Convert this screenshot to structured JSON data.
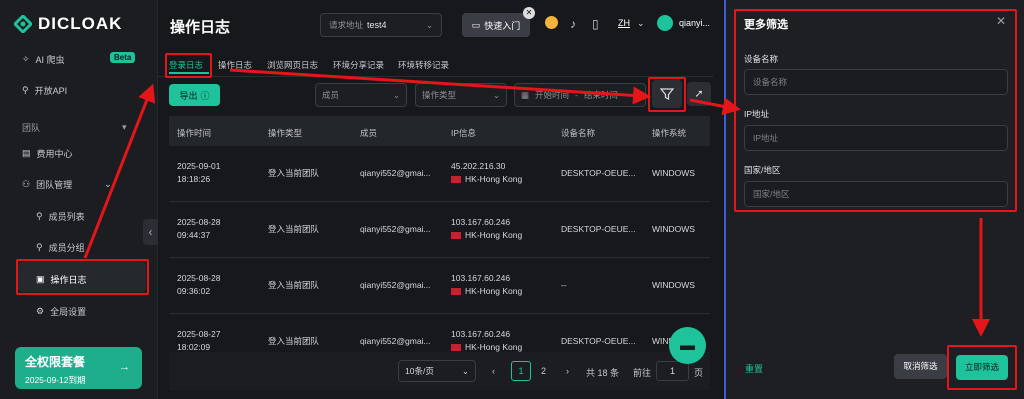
{
  "app": {
    "logo_text": "DICLOAK"
  },
  "sidebar": {
    "ai": "AI 爬虫",
    "ai_badge": "Beta",
    "api": "开放API",
    "team_section": "团队",
    "billing": "费用中心",
    "team_mgmt": "团队管理",
    "members": "成员列表",
    "groups": "成员分组",
    "logs": "操作日志",
    "settings": "全局设置",
    "package": {
      "title": "全权限套餐",
      "expire": "2025-09-12到期"
    }
  },
  "header": {
    "title": "操作日志",
    "address_label": "请求地址",
    "address_value": "test4",
    "quick_entry": "快速入门",
    "lang": "ZH",
    "username": "qianyi..."
  },
  "tabs": [
    "登录日志",
    "操作日志",
    "浏览网页日志",
    "环境分享记录",
    "环境转移记录"
  ],
  "toolbar": {
    "export": "导出",
    "member_placeholder": "成员",
    "type_placeholder": "操作类型",
    "start_time": "开始时间",
    "end_time": "结束时间"
  },
  "table": {
    "headers": [
      "操作时间",
      "操作类型",
      "成员",
      "IP信息",
      "设备名称",
      "操作系统"
    ],
    "rows": [
      {
        "date": "2025-09-01",
        "time": "18:18:26",
        "type": "登入当前团队",
        "member": "qianyi552@gmai...",
        "ip": "45.202.216.30",
        "region": "HK-Hong Kong",
        "device": "DESKTOP-OEUE...",
        "os": "WINDOWS"
      },
      {
        "date": "2025-08-28",
        "time": "09:44:37",
        "type": "登入当前团队",
        "member": "qianyi552@gmai...",
        "ip": "103.167.60.246",
        "region": "HK-Hong Kong",
        "device": "DESKTOP-OEUE...",
        "os": "WINDOWS"
      },
      {
        "date": "2025-08-28",
        "time": "09:36:02",
        "type": "登入当前团队",
        "member": "qianyi552@gmai...",
        "ip": "103.167.60.246",
        "region": "HK-Hong Kong",
        "device": "--",
        "os": "WINDOWS"
      },
      {
        "date": "2025-08-27",
        "time": "18:02:09",
        "type": "登入当前团队",
        "member": "qianyi552@gmai...",
        "ip": "103.167.60.246",
        "region": "HK-Hong Kong",
        "device": "DESKTOP-OEUE...",
        "os": "WINDOWS"
      }
    ]
  },
  "pagination": {
    "per_page": "10条/页",
    "page1": "1",
    "page2": "2",
    "total": "共 18 条",
    "goto": "前往",
    "goto_value": "1",
    "page_suffix": "页"
  },
  "panel": {
    "title": "更多筛选",
    "device_label": "设备名称",
    "device_placeholder": "设备名称",
    "ip_label": "IP地址",
    "ip_placeholder": "IP地址",
    "region_label": "国家/地区",
    "region_placeholder": "国家/地区",
    "reset": "重置",
    "cancel": "取消筛选",
    "apply": "立即筛选"
  },
  "colors": {
    "accent": "#1fc39b",
    "annotation": "#e3161a",
    "panel_border": "#3b5bdb"
  }
}
